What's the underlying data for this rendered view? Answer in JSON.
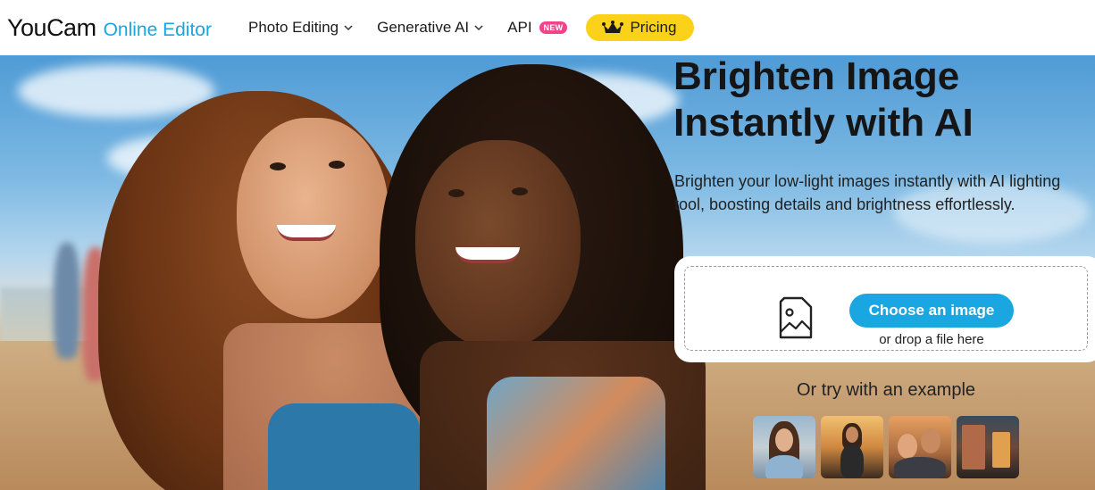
{
  "header": {
    "logo_brand": "YouCam",
    "logo_sub": "Online Editor",
    "nav": [
      {
        "label": "Photo Editing",
        "has_dropdown": true
      },
      {
        "label": "Generative AI",
        "has_dropdown": true
      },
      {
        "label": "API",
        "badge": "NEW"
      }
    ],
    "pricing_label": "Pricing",
    "pricing_icon": "crown-icon"
  },
  "hero": {
    "title_line1": "Brighten Image",
    "title_line2": "Instantly with AI",
    "description": "Brighten your low-light images instantly with AI lighting tool, boosting details and brightness effortlessly.",
    "upload": {
      "icon": "image-file-icon",
      "button_label": "Choose an image",
      "drop_text": "or drop a file here"
    },
    "try_example_text": "Or try with an example",
    "examples": [
      {
        "name": "example-woman-smiling"
      },
      {
        "name": "example-woman-sunset"
      },
      {
        "name": "example-couple"
      },
      {
        "name": "example-street"
      }
    ]
  },
  "colors": {
    "accent": "#1aa6e0",
    "pricing_bg": "#fbd119",
    "new_badge": "#f2448b"
  }
}
